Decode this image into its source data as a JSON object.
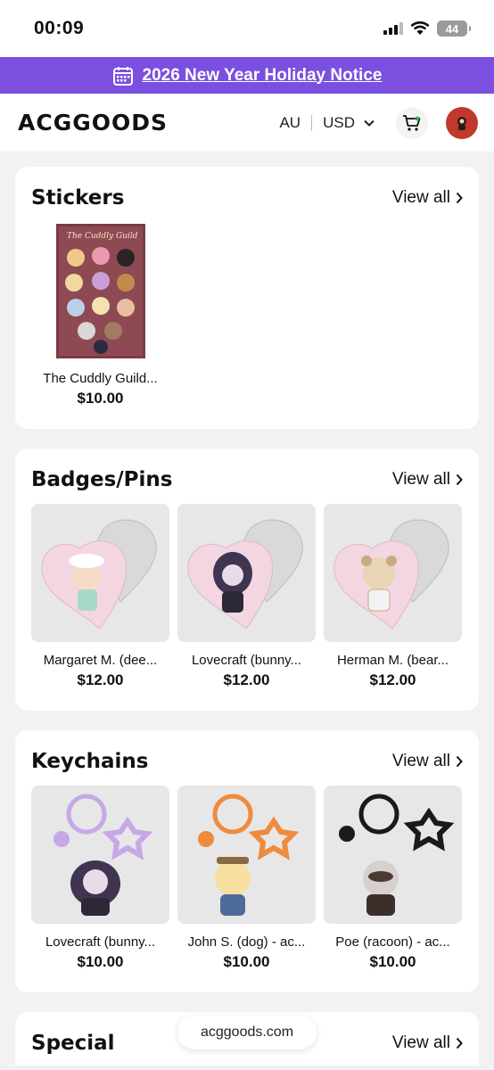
{
  "status": {
    "time": "00:09",
    "battery": "44"
  },
  "notice": {
    "text": "2026 New Year Holiday Notice"
  },
  "header": {
    "logo": "ACGGOODS",
    "region": "AU",
    "currency": "USD"
  },
  "sections": [
    {
      "title": "Stickers",
      "view_all": "View all",
      "products": [
        {
          "name": "The Cuddly Guild...",
          "price": "$10.00",
          "image_label": "The Cuddly Guild"
        }
      ]
    },
    {
      "title": "Badges/Pins",
      "view_all": "View all",
      "products": [
        {
          "name": "Margaret M. (dee...",
          "price": "$12.00"
        },
        {
          "name": "Lovecraft (bunny...",
          "price": "$12.00"
        },
        {
          "name": "Herman M. (bear...",
          "price": "$12.00"
        }
      ]
    },
    {
      "title": "Keychains",
      "view_all": "View all",
      "products": [
        {
          "name": "Lovecraft (bunny...",
          "price": "$10.00"
        },
        {
          "name": "John S. (dog) - ac...",
          "price": "$10.00"
        },
        {
          "name": "Poe (racoon) - ac...",
          "price": "$10.00"
        }
      ]
    },
    {
      "title": "Special",
      "view_all": "View all"
    }
  ],
  "url": "acggoods.com",
  "colors": {
    "notice_bg": "#7b4fe0",
    "avatar_bg": "#c0392b"
  }
}
